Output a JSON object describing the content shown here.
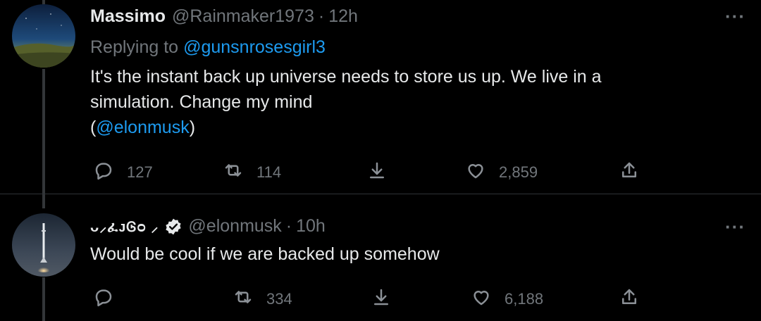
{
  "tweets": [
    {
      "name": "Massimo",
      "handle": "@Rainmaker1973",
      "separator": "·",
      "time": "12h",
      "replying_prefix": "Replying to",
      "replying_handle": "@gunsnrosesgirl3",
      "text_line1": "It's the instant back up universe needs to store us up. We live in a",
      "text_line2": "simulation. Change my mind",
      "text_line3_open": "(",
      "text_line3_mention": "@elonmusk",
      "text_line3_close": ")",
      "replies": "127",
      "retweets": "114",
      "likes": "2,859",
      "more_icon": "more-horizontal-icon"
    },
    {
      "name_glyphs": "ᴗ⸝ፈᴊᎶᴑ ⸝",
      "handle": "@elonmusk",
      "separator": "·",
      "time": "10h",
      "text_line1": "Would be cool if we are backed up somehow",
      "replies": "",
      "retweets": "334",
      "likes": "6,188",
      "more_icon": "more-horizontal-icon"
    }
  ],
  "colors": {
    "background": "#000000",
    "text": "#e7e9ea",
    "muted": "#71767b",
    "link": "#1d9bf0"
  }
}
